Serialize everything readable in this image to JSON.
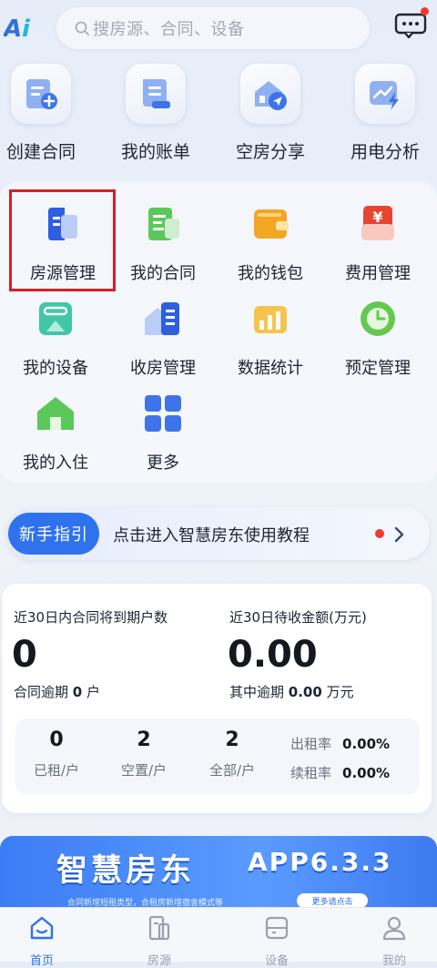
{
  "header": {
    "logo_text": "Ai",
    "search_placeholder": "搜房源、合同、设备",
    "message_icon": "message-icon",
    "has_unread": true
  },
  "quick_actions": [
    {
      "label": "创建合同",
      "icon": "create-contract-icon"
    },
    {
      "label": "我的账单",
      "icon": "bill-icon"
    },
    {
      "label": "空房分享",
      "icon": "share-vacancy-icon"
    },
    {
      "label": "用电分析",
      "icon": "power-analysis-icon"
    }
  ],
  "grid": [
    {
      "label": "房源管理",
      "icon": "property-icon",
      "highlighted": true
    },
    {
      "label": "我的合同",
      "icon": "contract-icon"
    },
    {
      "label": "我的钱包",
      "icon": "wallet-icon"
    },
    {
      "label": "费用管理",
      "icon": "fee-icon"
    },
    {
      "label": "我的设备",
      "icon": "device-icon"
    },
    {
      "label": "收房管理",
      "icon": "collect-house-icon"
    },
    {
      "label": "数据统计",
      "icon": "statistics-icon"
    },
    {
      "label": "预定管理",
      "icon": "reservation-icon"
    },
    {
      "label": "我的入住",
      "icon": "checkin-icon"
    },
    {
      "label": "更多",
      "icon": "more-icon"
    }
  ],
  "guide": {
    "pill": "新手指引",
    "text": "点击进入智慧房东使用教程"
  },
  "stats": {
    "expiring_label": "近30日内合同将到期户数",
    "expiring_value": "0",
    "overdue_prefix": "合同逾期",
    "overdue_value": "0",
    "overdue_unit": "户",
    "receivable_label": "近30日待收金额(万元)",
    "receivable_value": "0.00",
    "receivable_overdue_prefix": "其中逾期",
    "receivable_overdue_value": "0.00",
    "receivable_overdue_unit": "万元",
    "counts": [
      {
        "value": "0",
        "label": "已租/户"
      },
      {
        "value": "2",
        "label": "空置/户"
      },
      {
        "value": "2",
        "label": "全部/户"
      }
    ],
    "rent_rate_label": "出租率",
    "rent_rate_value": "0.00%",
    "renew_rate_label": "续租率",
    "renew_rate_value": "0.00%"
  },
  "promo": {
    "title": "智慧房东",
    "version": "APP6.3.3",
    "subtitle": "合同新增短租类型，合租房新增宿舍模式等",
    "more": "更多请点击"
  },
  "tabs": [
    {
      "label": "首页",
      "icon": "home-icon",
      "active": true
    },
    {
      "label": "房源",
      "icon": "property-tab-icon"
    },
    {
      "label": "设备",
      "icon": "device-tab-icon"
    },
    {
      "label": "我的",
      "icon": "profile-icon"
    }
  ],
  "colors": {
    "accent": "#2f72ee",
    "highlight": "#d51f2a",
    "dot": "#ee3b2e",
    "tab_active": "#2f72ee",
    "tab_inactive": "#9aa0ad"
  }
}
